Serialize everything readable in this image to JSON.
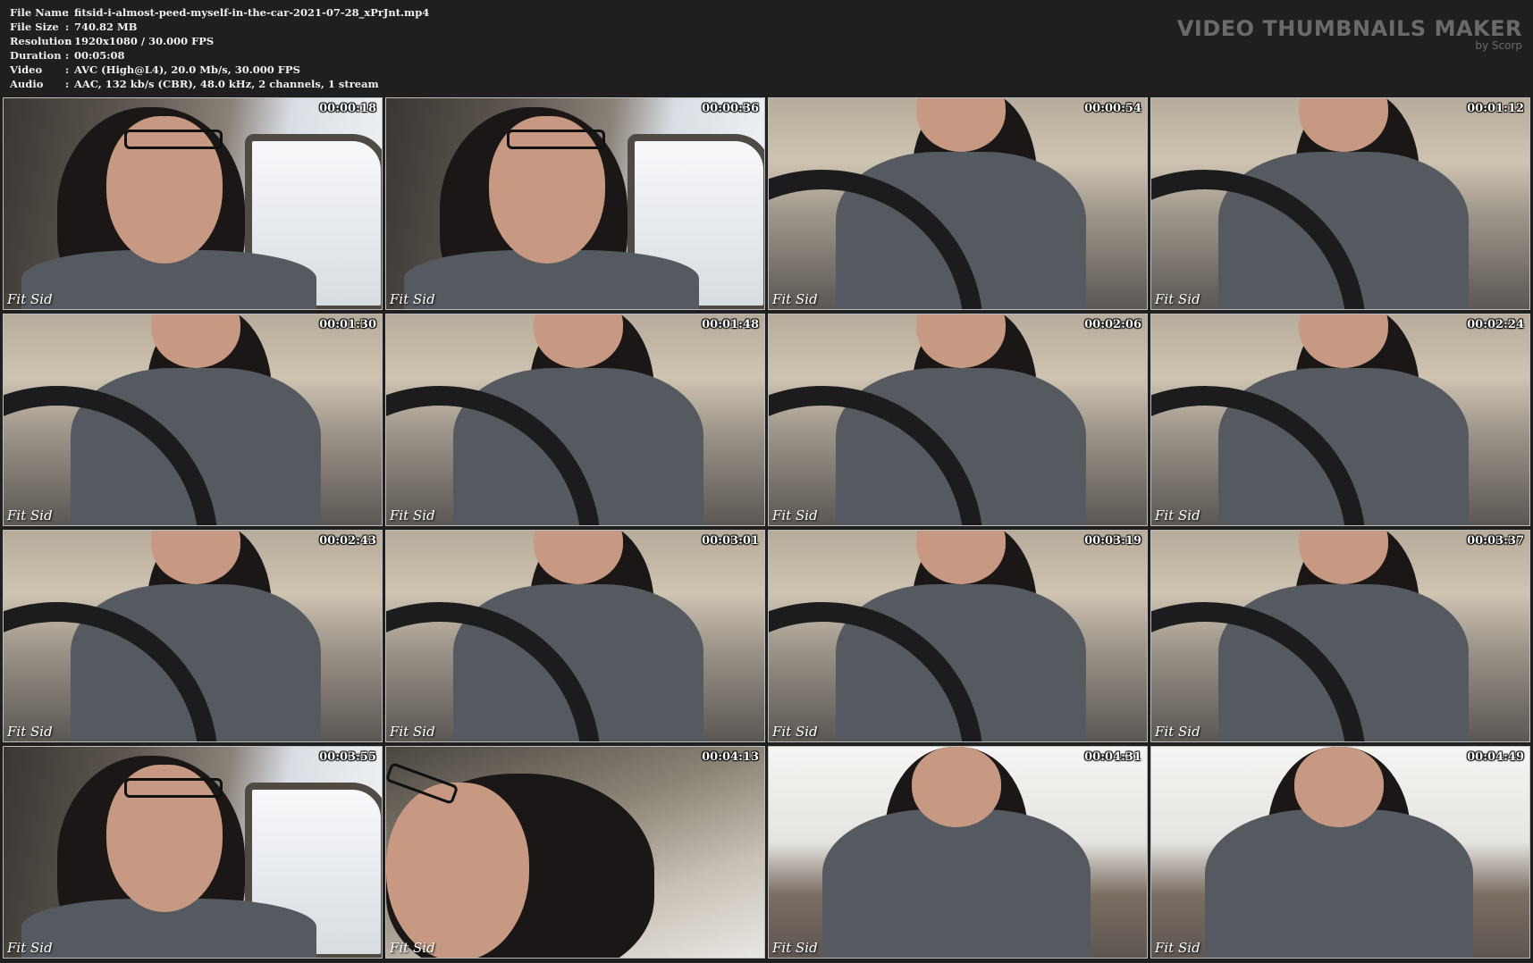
{
  "info": {
    "rows": [
      {
        "key": "File Name",
        "value": "fitsid-i-almost-peed-myself-in-the-car-2021-07-28_xPrJnt.mp4"
      },
      {
        "key": "File Size",
        "value": "740.82 MB"
      },
      {
        "key": "Resolution",
        "value": "1920x1080 / 30.000 FPS"
      },
      {
        "key": "Duration",
        "value": "00:05:08"
      },
      {
        "key": "Video",
        "value": "AVC (High@L4), 20.0 Mb/s, 30.000 FPS"
      },
      {
        "key": "Audio",
        "value": "AAC, 132 kb/s (CBR), 48.0 kHz, 2 channels, 1 stream"
      }
    ],
    "separator": ":"
  },
  "brand": {
    "title": "VIDEO THUMBNAILS MAKER",
    "subtitle": "by Scorp"
  },
  "thumbnails": [
    {
      "time": "00:00:18",
      "scene": "car-left"
    },
    {
      "time": "00:00:36",
      "scene": "car-left"
    },
    {
      "time": "00:00:54",
      "scene": "seats"
    },
    {
      "time": "00:01:12",
      "scene": "seats"
    },
    {
      "time": "00:01:30",
      "scene": "seats"
    },
    {
      "time": "00:01:48",
      "scene": "seats"
    },
    {
      "time": "00:02:06",
      "scene": "seats"
    },
    {
      "time": "00:02:24",
      "scene": "seats"
    },
    {
      "time": "00:02:43",
      "scene": "seats"
    },
    {
      "time": "00:03:01",
      "scene": "seats"
    },
    {
      "time": "00:03:19",
      "scene": "seats"
    },
    {
      "time": "00:03:37",
      "scene": "seats"
    },
    {
      "time": "00:03:55",
      "scene": "car-left"
    },
    {
      "time": "00:04:13",
      "scene": "ceiling"
    },
    {
      "time": "00:04:31",
      "scene": "outdoor"
    },
    {
      "time": "00:04:49",
      "scene": "outdoor"
    }
  ],
  "watermark": "Fit Sid",
  "colors": {
    "background": "#1f1f1f",
    "text": "#ececec",
    "brand": "#6a6a6a",
    "border": "#bdbdbd"
  }
}
